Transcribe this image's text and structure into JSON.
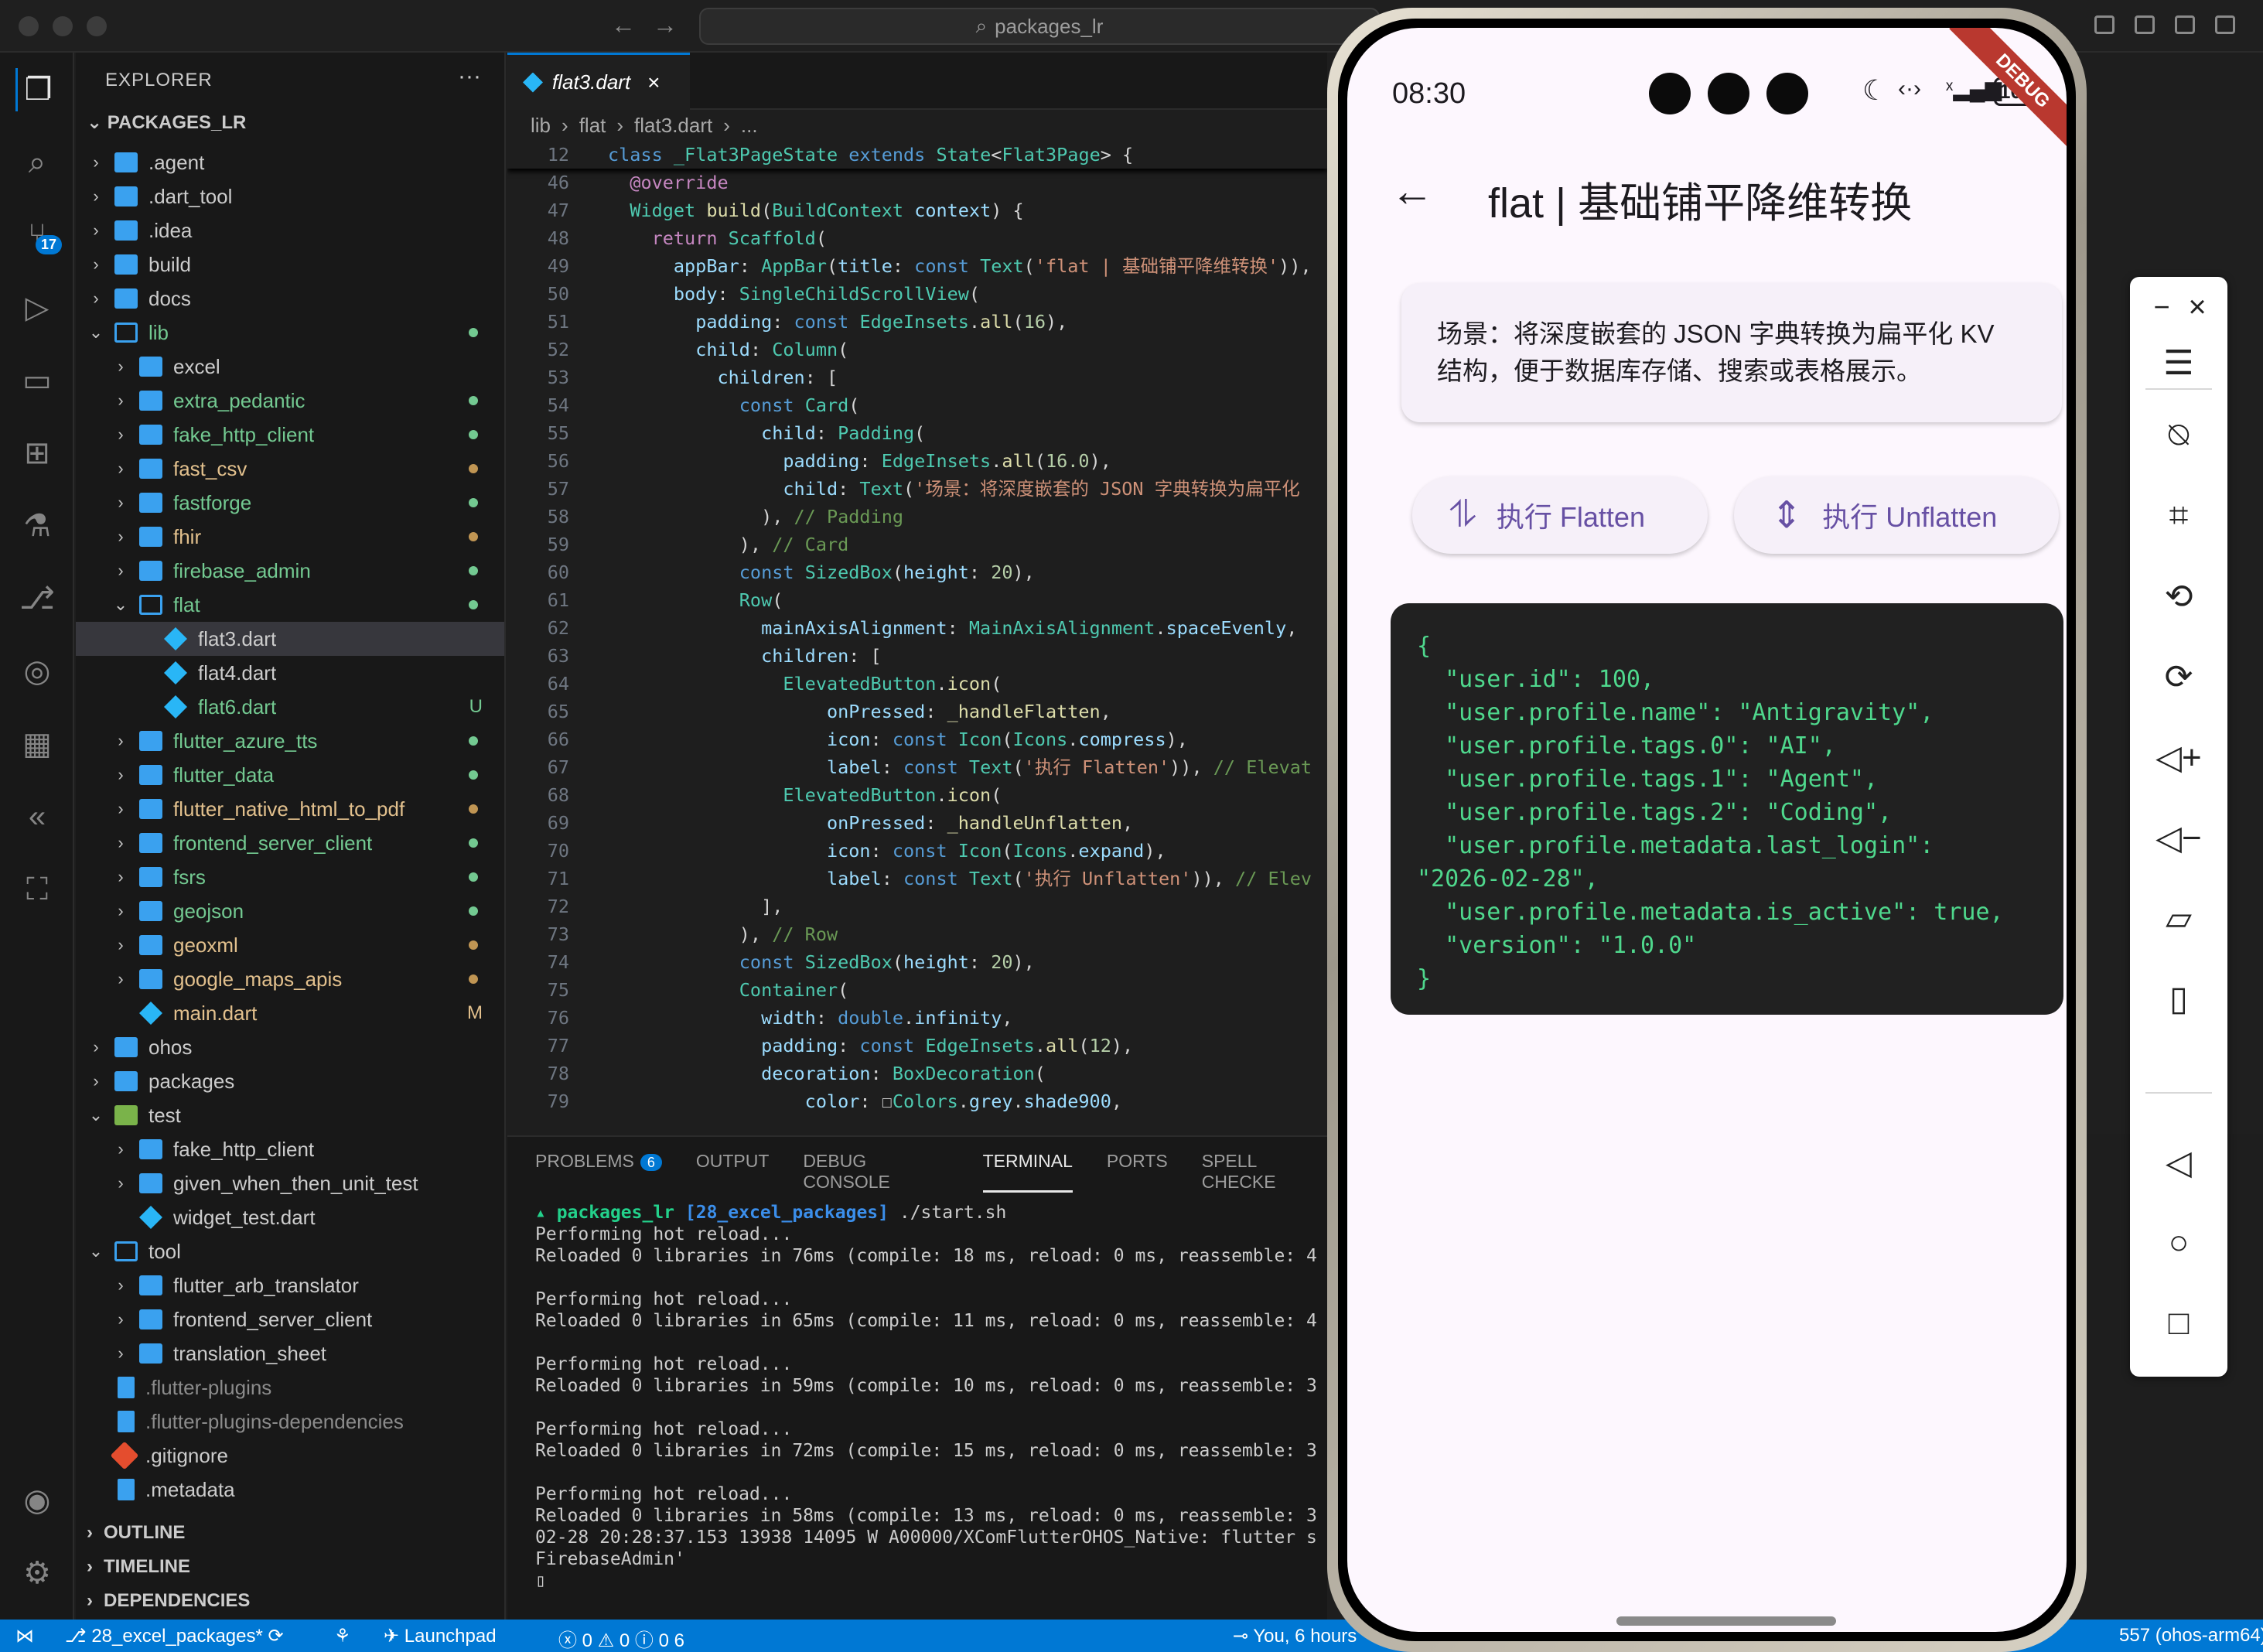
{
  "window": {
    "search": "packages_lr"
  },
  "activity": {
    "scm_badge": "17"
  },
  "explorer": {
    "title": "EXPLORER",
    "more": "···",
    "root": "PACKAGES_LR",
    "items": [
      {
        "label": ".agent",
        "kind": "folder",
        "depth": 0,
        "chev": "›",
        "color": "#cccccc"
      },
      {
        "label": ".dart_tool",
        "kind": "folder",
        "depth": 0,
        "chev": "›",
        "color": "#cccccc"
      },
      {
        "label": ".idea",
        "kind": "folder",
        "depth": 0,
        "chev": "›",
        "color": "#cccccc"
      },
      {
        "label": "build",
        "kind": "gear",
        "depth": 0,
        "chev": "›",
        "color": "#cccccc"
      },
      {
        "label": "docs",
        "kind": "folder",
        "depth": 0,
        "chev": "›",
        "color": "#cccccc"
      },
      {
        "label": "lib",
        "kind": "folderopen",
        "depth": 0,
        "chev": "⌄",
        "color": "#73c991",
        "dot": "#73c991"
      },
      {
        "label": "excel",
        "kind": "folder",
        "depth": 1,
        "chev": "›",
        "color": "#cccccc"
      },
      {
        "label": "extra_pedantic",
        "kind": "folder",
        "depth": 1,
        "chev": "›",
        "color": "#73c991",
        "dot": "#73c991"
      },
      {
        "label": "fake_http_client",
        "kind": "folder",
        "depth": 1,
        "chev": "›",
        "color": "#73c991",
        "dot": "#73c991"
      },
      {
        "label": "fast_csv",
        "kind": "folder",
        "depth": 1,
        "chev": "›",
        "color": "#e2c08d",
        "dot": "#c09553"
      },
      {
        "label": "fastforge",
        "kind": "folder",
        "depth": 1,
        "chev": "›",
        "color": "#73c991",
        "dot": "#73c991"
      },
      {
        "label": "fhir",
        "kind": "folder",
        "depth": 1,
        "chev": "›",
        "color": "#e2c08d",
        "dot": "#c09553"
      },
      {
        "label": "firebase_admin",
        "kind": "folder",
        "depth": 1,
        "chev": "›",
        "color": "#73c991",
        "dot": "#73c991"
      },
      {
        "label": "flat",
        "kind": "folderopen",
        "depth": 1,
        "chev": "⌄",
        "color": "#73c991",
        "dot": "#73c991"
      },
      {
        "label": "flat3.dart",
        "kind": "dart",
        "depth": 2,
        "chev": "",
        "color": "#cccccc",
        "selected": true
      },
      {
        "label": "flat4.dart",
        "kind": "dart",
        "depth": 2,
        "chev": "",
        "color": "#cccccc"
      },
      {
        "label": "flat6.dart",
        "kind": "dart",
        "depth": 2,
        "chev": "",
        "color": "#73c991",
        "mark": "U"
      },
      {
        "label": "flutter_azure_tts",
        "kind": "folder",
        "depth": 1,
        "chev": "›",
        "color": "#73c991",
        "dot": "#73c991"
      },
      {
        "label": "flutter_data",
        "kind": "folder",
        "depth": 1,
        "chev": "›",
        "color": "#73c991",
        "dot": "#73c991"
      },
      {
        "label": "flutter_native_html_to_pdf",
        "kind": "folder",
        "depth": 1,
        "chev": "›",
        "color": "#e2c08d",
        "dot": "#c09553"
      },
      {
        "label": "frontend_server_client",
        "kind": "folder",
        "depth": 1,
        "chev": "›",
        "color": "#73c991",
        "dot": "#73c991"
      },
      {
        "label": "fsrs",
        "kind": "folder",
        "depth": 1,
        "chev": "›",
        "color": "#73c991",
        "dot": "#73c991"
      },
      {
        "label": "geojson",
        "kind": "folder",
        "depth": 1,
        "chev": "›",
        "color": "#73c991",
        "dot": "#73c991"
      },
      {
        "label": "geoxml",
        "kind": "folder",
        "depth": 1,
        "chev": "›",
        "color": "#e2c08d",
        "dot": "#c09553"
      },
      {
        "label": "google_maps_apis",
        "kind": "folder",
        "depth": 1,
        "chev": "›",
        "color": "#e2c08d",
        "dot": "#c09553"
      },
      {
        "label": "main.dart",
        "kind": "dart",
        "depth": 1,
        "chev": "",
        "color": "#e2c08d",
        "mark": "M"
      },
      {
        "label": "ohos",
        "kind": "folder",
        "depth": 0,
        "chev": "›",
        "color": "#cccccc"
      },
      {
        "label": "packages",
        "kind": "folder",
        "depth": 0,
        "chev": "›",
        "color": "#cccccc"
      },
      {
        "label": "test",
        "kind": "foldergreen",
        "depth": 0,
        "chev": "⌄",
        "color": "#cccccc"
      },
      {
        "label": "fake_http_client",
        "kind": "folder",
        "depth": 1,
        "chev": "›",
        "color": "#cccccc"
      },
      {
        "label": "given_when_then_unit_test",
        "kind": "folder",
        "depth": 1,
        "chev": "›",
        "color": "#cccccc"
      },
      {
        "label": "widget_test.dart",
        "kind": "dart",
        "depth": 1,
        "chev": "",
        "color": "#cccccc"
      },
      {
        "label": "tool",
        "kind": "folderopen",
        "depth": 0,
        "chev": "⌄",
        "color": "#cccccc"
      },
      {
        "label": "flutter_arb_translator",
        "kind": "folder",
        "depth": 1,
        "chev": "›",
        "color": "#cccccc"
      },
      {
        "label": "frontend_server_client",
        "kind": "folder",
        "depth": 1,
        "chev": "›",
        "color": "#cccccc"
      },
      {
        "label": "translation_sheet",
        "kind": "folder",
        "depth": 1,
        "chev": "›",
        "color": "#cccccc"
      },
      {
        "label": ".flutter-plugins",
        "kind": "file",
        "depth": 0,
        "chev": "",
        "color": "#8b8b8b"
      },
      {
        "label": ".flutter-plugins-dependencies",
        "kind": "file",
        "depth": 0,
        "chev": "",
        "color": "#8b8b8b"
      },
      {
        "label": ".gitignore",
        "kind": "git",
        "depth": 0,
        "chev": "",
        "color": "#cccccc"
      },
      {
        "label": ".metadata",
        "kind": "file",
        "depth": 0,
        "chev": "",
        "color": "#cccccc"
      }
    ],
    "sections": [
      "OUTLINE",
      "TIMELINE",
      "DEPENDENCIES"
    ]
  },
  "editor": {
    "tab": "flat3.dart",
    "breadcrumb": [
      "lib",
      "›",
      "flat",
      "›",
      "flat3.dart",
      "›",
      "..."
    ],
    "sticky": {
      "n": "12",
      "html": "<span class='kw'>class</span> <span class='cls'>_Flat3PageState</span> <span class='kw'>extends</span> <span class='cls'>State</span>&lt;<span class='cls'>Flat3Page</span>&gt; {"
    },
    "lines": [
      {
        "n": "46",
        "html": "  <span class='ann'>@override</span>"
      },
      {
        "n": "47",
        "html": "  <span class='cls'>Widget</span> <span class='fn'>build</span>(<span class='cls'>BuildContext</span> <span class='prop'>context</span>) {"
      },
      {
        "n": "48",
        "html": "    <span class='ann'>return</span> <span class='cls'>Scaffold</span>("
      },
      {
        "n": "49",
        "html": "      <span class='prop'>appBar</span>: <span class='cls'>AppBar</span>(<span class='prop'>title</span>: <span class='kw'>const</span> <span class='cls'>Text</span>(<span class='str'>'flat | 基础铺平降维转换'</span>)),"
      },
      {
        "n": "50",
        "html": "      <span class='prop'>body</span>: <span class='cls'>SingleChildScrollView</span>("
      },
      {
        "n": "51",
        "html": "        <span class='prop'>padding</span>: <span class='kw'>const</span> <span class='cls'>EdgeInsets</span>.<span class='fn'>all</span>(<span class='num'>16</span>),"
      },
      {
        "n": "52",
        "html": "        <span class='prop'>child</span>: <span class='cls'>Column</span>("
      },
      {
        "n": "53",
        "html": "          <span class='prop'>children</span>: ["
      },
      {
        "n": "54",
        "html": "            <span class='kw'>const</span> <span class='cls'>Card</span>("
      },
      {
        "n": "55",
        "html": "              <span class='prop'>child</span>: <span class='cls'>Padding</span>("
      },
      {
        "n": "56",
        "html": "                <span class='prop'>padding</span>: <span class='cls'>EdgeInsets</span>.<span class='fn'>all</span>(<span class='num'>16.0</span>),"
      },
      {
        "n": "57",
        "html": "                <span class='prop'>child</span>: <span class='cls'>Text</span>(<span class='str'>'场景：将深度嵌套的 JSON 字典转换为扁平化</span>"
      },
      {
        "n": "58",
        "html": "              ), <span class='cm'>// Padding</span>"
      },
      {
        "n": "59",
        "html": "            ), <span class='cm'>// Card</span>"
      },
      {
        "n": "60",
        "html": "            <span class='kw'>const</span> <span class='cls'>SizedBox</span>(<span class='prop'>height</span>: <span class='num'>20</span>),"
      },
      {
        "n": "61",
        "html": "            <span class='cls'>Row</span>("
      },
      {
        "n": "62",
        "html": "              <span class='prop'>mainAxisAlignment</span>: <span class='cls'>MainAxisAlignment</span>.<span class='prop'>spaceEvenly</span>,"
      },
      {
        "n": "63",
        "html": "              <span class='prop'>children</span>: ["
      },
      {
        "n": "64",
        "html": "                <span class='cls'>ElevatedButton</span>.<span class='fn'>icon</span>("
      },
      {
        "n": "65",
        "html": "                    <span class='prop'>onPressed</span>: <span class='fn'>_handleFlatten</span>,"
      },
      {
        "n": "66",
        "html": "                    <span class='prop'>icon</span>: <span class='kw'>const</span> <span class='cls'>Icon</span>(<span class='cls'>Icons</span>.<span class='prop'>compress</span>),"
      },
      {
        "n": "67",
        "html": "                    <span class='prop'>label</span>: <span class='kw'>const</span> <span class='cls'>Text</span>(<span class='str'>'执行 Flatten'</span>)), <span class='cm'>// Elevat</span>"
      },
      {
        "n": "68",
        "html": "                <span class='cls'>ElevatedButton</span>.<span class='fn'>icon</span>("
      },
      {
        "n": "69",
        "html": "                    <span class='prop'>onPressed</span>: <span class='fn'>_handleUnflatten</span>,"
      },
      {
        "n": "70",
        "html": "                    <span class='prop'>icon</span>: <span class='kw'>const</span> <span class='cls'>Icon</span>(<span class='cls'>Icons</span>.<span class='prop'>expand</span>),"
      },
      {
        "n": "71",
        "html": "                    <span class='prop'>label</span>: <span class='kw'>const</span> <span class='cls'>Text</span>(<span class='str'>'执行 Unflatten'</span>)), <span class='cm'>// Elev</span>"
      },
      {
        "n": "72",
        "html": "              ],"
      },
      {
        "n": "73",
        "html": "            ), <span class='cm'>// Row</span>"
      },
      {
        "n": "74",
        "html": "            <span class='kw'>const</span> <span class='cls'>SizedBox</span>(<span class='prop'>height</span>: <span class='num'>20</span>),"
      },
      {
        "n": "75",
        "html": "            <span class='cls'>Container</span>("
      },
      {
        "n": "76",
        "html": "              <span class='prop'>width</span>: <span class='kw'>double</span>.<span class='prop'>infinity</span>,"
      },
      {
        "n": "77",
        "html": "              <span class='prop'>padding</span>: <span class='kw'>const</span> <span class='cls'>EdgeInsets</span>.<span class='fn'>all</span>(<span class='num'>12</span>),"
      },
      {
        "n": "78",
        "html": "              <span class='prop'>decoration</span>: <span class='cls'>BoxDecoration</span>("
      },
      {
        "n": "79",
        "html": "                  <span class='prop'>color</span>: ☐<span class='cls'>Colors</span>.<span class='prop'>grey</span>.<span class='prop'>shade900</span>,"
      }
    ]
  },
  "panel": {
    "tabs": [
      "PROBLEMS",
      "OUTPUT",
      "DEBUG CONSOLE",
      "TERMINAL",
      "PORTS",
      "SPELL CHECKE"
    ],
    "problems_count": "6",
    "prompt_dir": "packages_lr",
    "prompt_branch": "[28_excel_packages]",
    "prompt_cmd": "./start.sh",
    "terminal": "\nPerforming hot reload...\nReloaded 0 libraries in 76ms (compile: 18 ms, reload: 0 ms, reassemble: 4\n\nPerforming hot reload...\nReloaded 0 libraries in 65ms (compile: 11 ms, reload: 0 ms, reassemble: 4\n\nPerforming hot reload...\nReloaded 0 libraries in 59ms (compile: 10 ms, reload: 0 ms, reassemble: 3\n\nPerforming hot reload...\nReloaded 0 libraries in 72ms (compile: 15 ms, reload: 0 ms, reassemble: 3\n\nPerforming hot reload...\nReloaded 0 libraries in 58ms (compile: 13 ms, reload: 0 ms, reassemble: 3\n02-28 20:28:37.153 13938 14095 W A00000/XComFlutterOHOS_Native: flutter s\nFirebaseAdmin'\n▯"
  },
  "statusbar": {
    "branch": "28_excel_packages*",
    "launchpad": "Launchpad",
    "errors": "0",
    "warnings": "0",
    "info": "0",
    "ports": "6",
    "blame": "You, 6 hours",
    "target": "557 (ohos-arm64)"
  },
  "phone": {
    "time": "08:30",
    "battery": "100",
    "debug": "DEBUG",
    "title": "flat | 基础铺平降维转换",
    "card": "场景：将深度嵌套的 JSON 字典转换为扁平化 KV 结构，便于数据库存储、搜索或表格展示。",
    "btn_flatten": "执行 Flatten",
    "btn_unflatten": "执行 Unflatten",
    "json": "{\n  \"user.id\": 100,\n  \"user.profile.name\": \"Antigravity\",\n  \"user.profile.tags.0\": \"AI\",\n  \"user.profile.tags.1\": \"Agent\",\n  \"user.profile.tags.2\": \"Coding\",\n  \"user.profile.metadata.last_login\":\n\"2026-02-28\",\n  \"user.profile.metadata.is_active\": true,\n  \"version\": \"1.0.0\"\n}"
  },
  "colors": {
    "accent": "#0078d4",
    "json_text": "#4fd88d",
    "primary": "#6750a4"
  }
}
